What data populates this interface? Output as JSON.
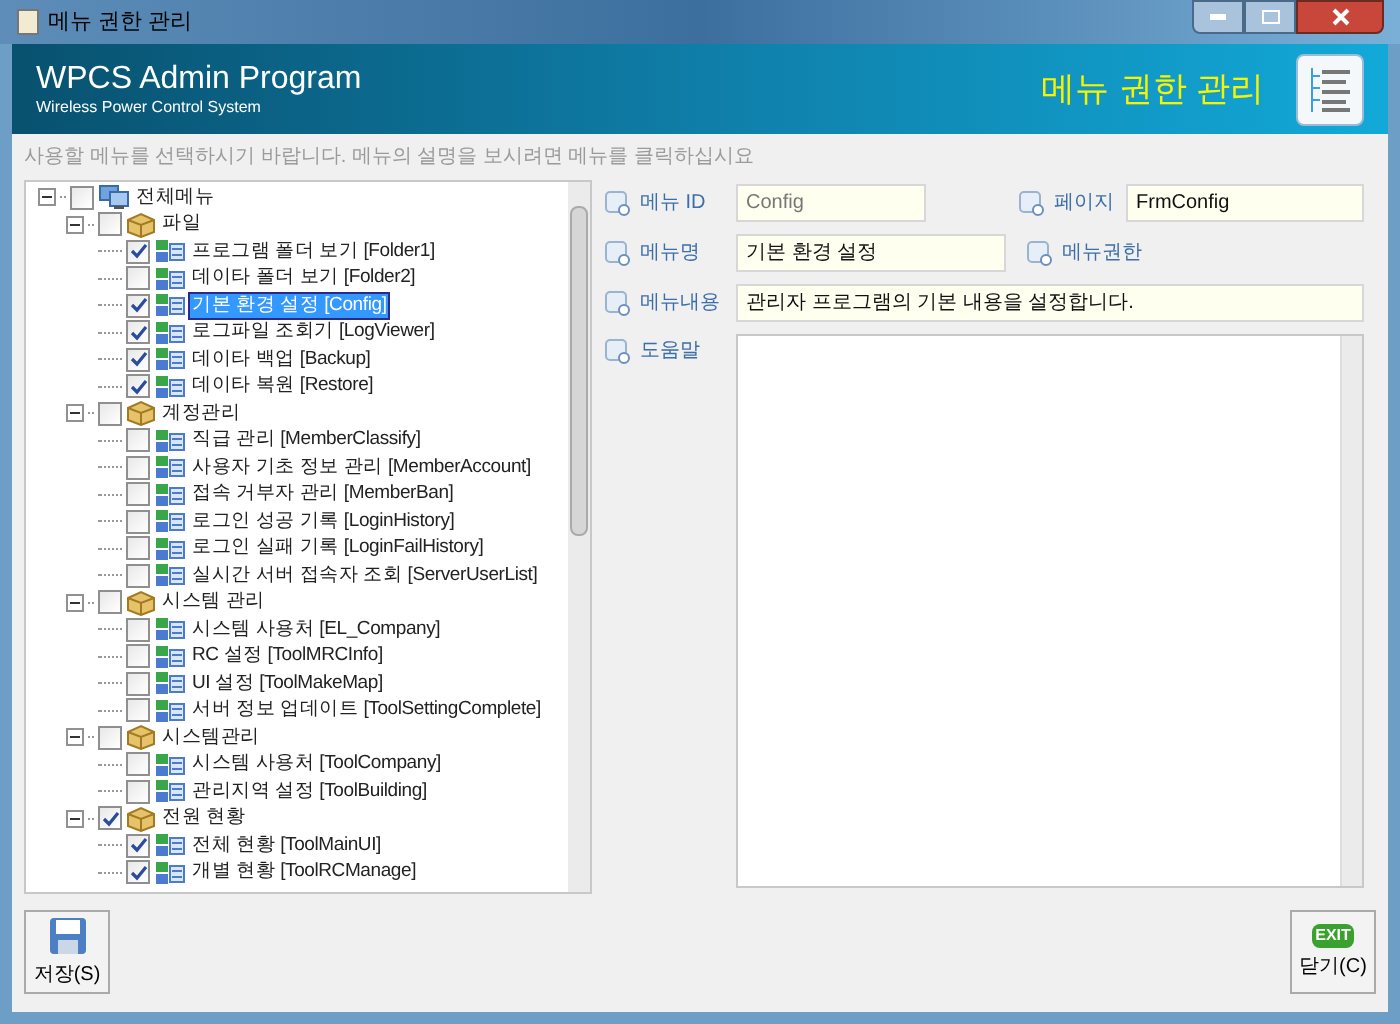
{
  "window": {
    "title": "메뉴 권한 관리"
  },
  "header": {
    "app_title": "WPCS Admin Program",
    "subtitle": "Wireless Power Control System",
    "page_title": "메뉴 권한 관리"
  },
  "hint": "사용할 메뉴를 선택하시기 바랍니다. 메뉴의 설명을 보시려면 메뉴를 클릭하십시요",
  "tree": [
    {
      "label": "전체메뉴",
      "kind": "root",
      "checked": false,
      "expanded": true,
      "selected": false,
      "children": [
        {
          "label": "파일",
          "kind": "group",
          "checked": false,
          "expanded": true,
          "selected": false,
          "children": [
            {
              "label": "프로그램 폴더 보기 [Folder1]",
              "kind": "item",
              "checked": true,
              "selected": false
            },
            {
              "label": "데이타 폴더 보기 [Folder2]",
              "kind": "item",
              "checked": false,
              "selected": false
            },
            {
              "label": "기본 환경 설정 [Config]",
              "kind": "item",
              "checked": true,
              "selected": true
            },
            {
              "label": "로그파일 조회기 [LogViewer]",
              "kind": "item",
              "checked": true,
              "selected": false
            },
            {
              "label": "데이타 백업 [Backup]",
              "kind": "item",
              "checked": true,
              "selected": false
            },
            {
              "label": "데이타 복원 [Restore]",
              "kind": "item",
              "checked": true,
              "selected": false
            }
          ]
        },
        {
          "label": "계정관리",
          "kind": "group",
          "checked": false,
          "expanded": true,
          "selected": false,
          "children": [
            {
              "label": "직급 관리 [MemberClassify]",
              "kind": "item",
              "checked": false,
              "selected": false
            },
            {
              "label": "사용자 기초 정보 관리 [MemberAccount]",
              "kind": "item",
              "checked": false,
              "selected": false
            },
            {
              "label": "접속 거부자 관리 [MemberBan]",
              "kind": "item",
              "checked": false,
              "selected": false
            },
            {
              "label": "로그인 성공 기록 [LoginHistory]",
              "kind": "item",
              "checked": false,
              "selected": false
            },
            {
              "label": "로그인 실패 기록 [LoginFailHistory]",
              "kind": "item",
              "checked": false,
              "selected": false
            },
            {
              "label": "실시간 서버 접속자 조회 [ServerUserList]",
              "kind": "item",
              "checked": false,
              "selected": false
            }
          ]
        },
        {
          "label": "시스템 관리",
          "kind": "group",
          "checked": false,
          "expanded": true,
          "selected": false,
          "children": [
            {
              "label": "시스템 사용처 [EL_Company]",
              "kind": "item",
              "checked": false,
              "selected": false
            },
            {
              "label": "RC 설정 [ToolMRCInfo]",
              "kind": "item",
              "checked": false,
              "selected": false
            },
            {
              "label": "UI 설정 [ToolMakeMap]",
              "kind": "item",
              "checked": false,
              "selected": false
            },
            {
              "label": "서버 정보 업데이트 [ToolSettingComplete]",
              "kind": "item",
              "checked": false,
              "selected": false
            }
          ]
        },
        {
          "label": "시스템관리",
          "kind": "group",
          "checked": false,
          "expanded": true,
          "selected": false,
          "children": [
            {
              "label": "시스템 사용처 [ToolCompany]",
              "kind": "item",
              "checked": false,
              "selected": false
            },
            {
              "label": "관리지역 설정 [ToolBuilding]",
              "kind": "item",
              "checked": false,
              "selected": false
            }
          ]
        },
        {
          "label": "전원 현황",
          "kind": "group",
          "checked": true,
          "expanded": true,
          "selected": false,
          "children": [
            {
              "label": "전체 현황 [ToolMainUI]",
              "kind": "item",
              "checked": true,
              "selected": false
            },
            {
              "label": "개별 현황 [ToolRCManage]",
              "kind": "item",
              "checked": true,
              "selected": false
            }
          ]
        }
      ]
    }
  ],
  "form": {
    "menu_id": {
      "label": "메뉴 ID",
      "value": "Config",
      "disabled": true
    },
    "page": {
      "label": "페이지",
      "value": "FrmConfig"
    },
    "menu_name": {
      "label": "메뉴명",
      "value": "기본 환경 설정"
    },
    "permission": {
      "label": "메뉴권한"
    },
    "description": {
      "label": "메뉴내용",
      "value": "관리자 프로그램의 기본 내용을 설정합니다."
    },
    "help": {
      "label": "도움말"
    }
  },
  "buttons": {
    "save": "저장(S)",
    "exit_badge": "EXIT",
    "close": "닫기(C)"
  }
}
